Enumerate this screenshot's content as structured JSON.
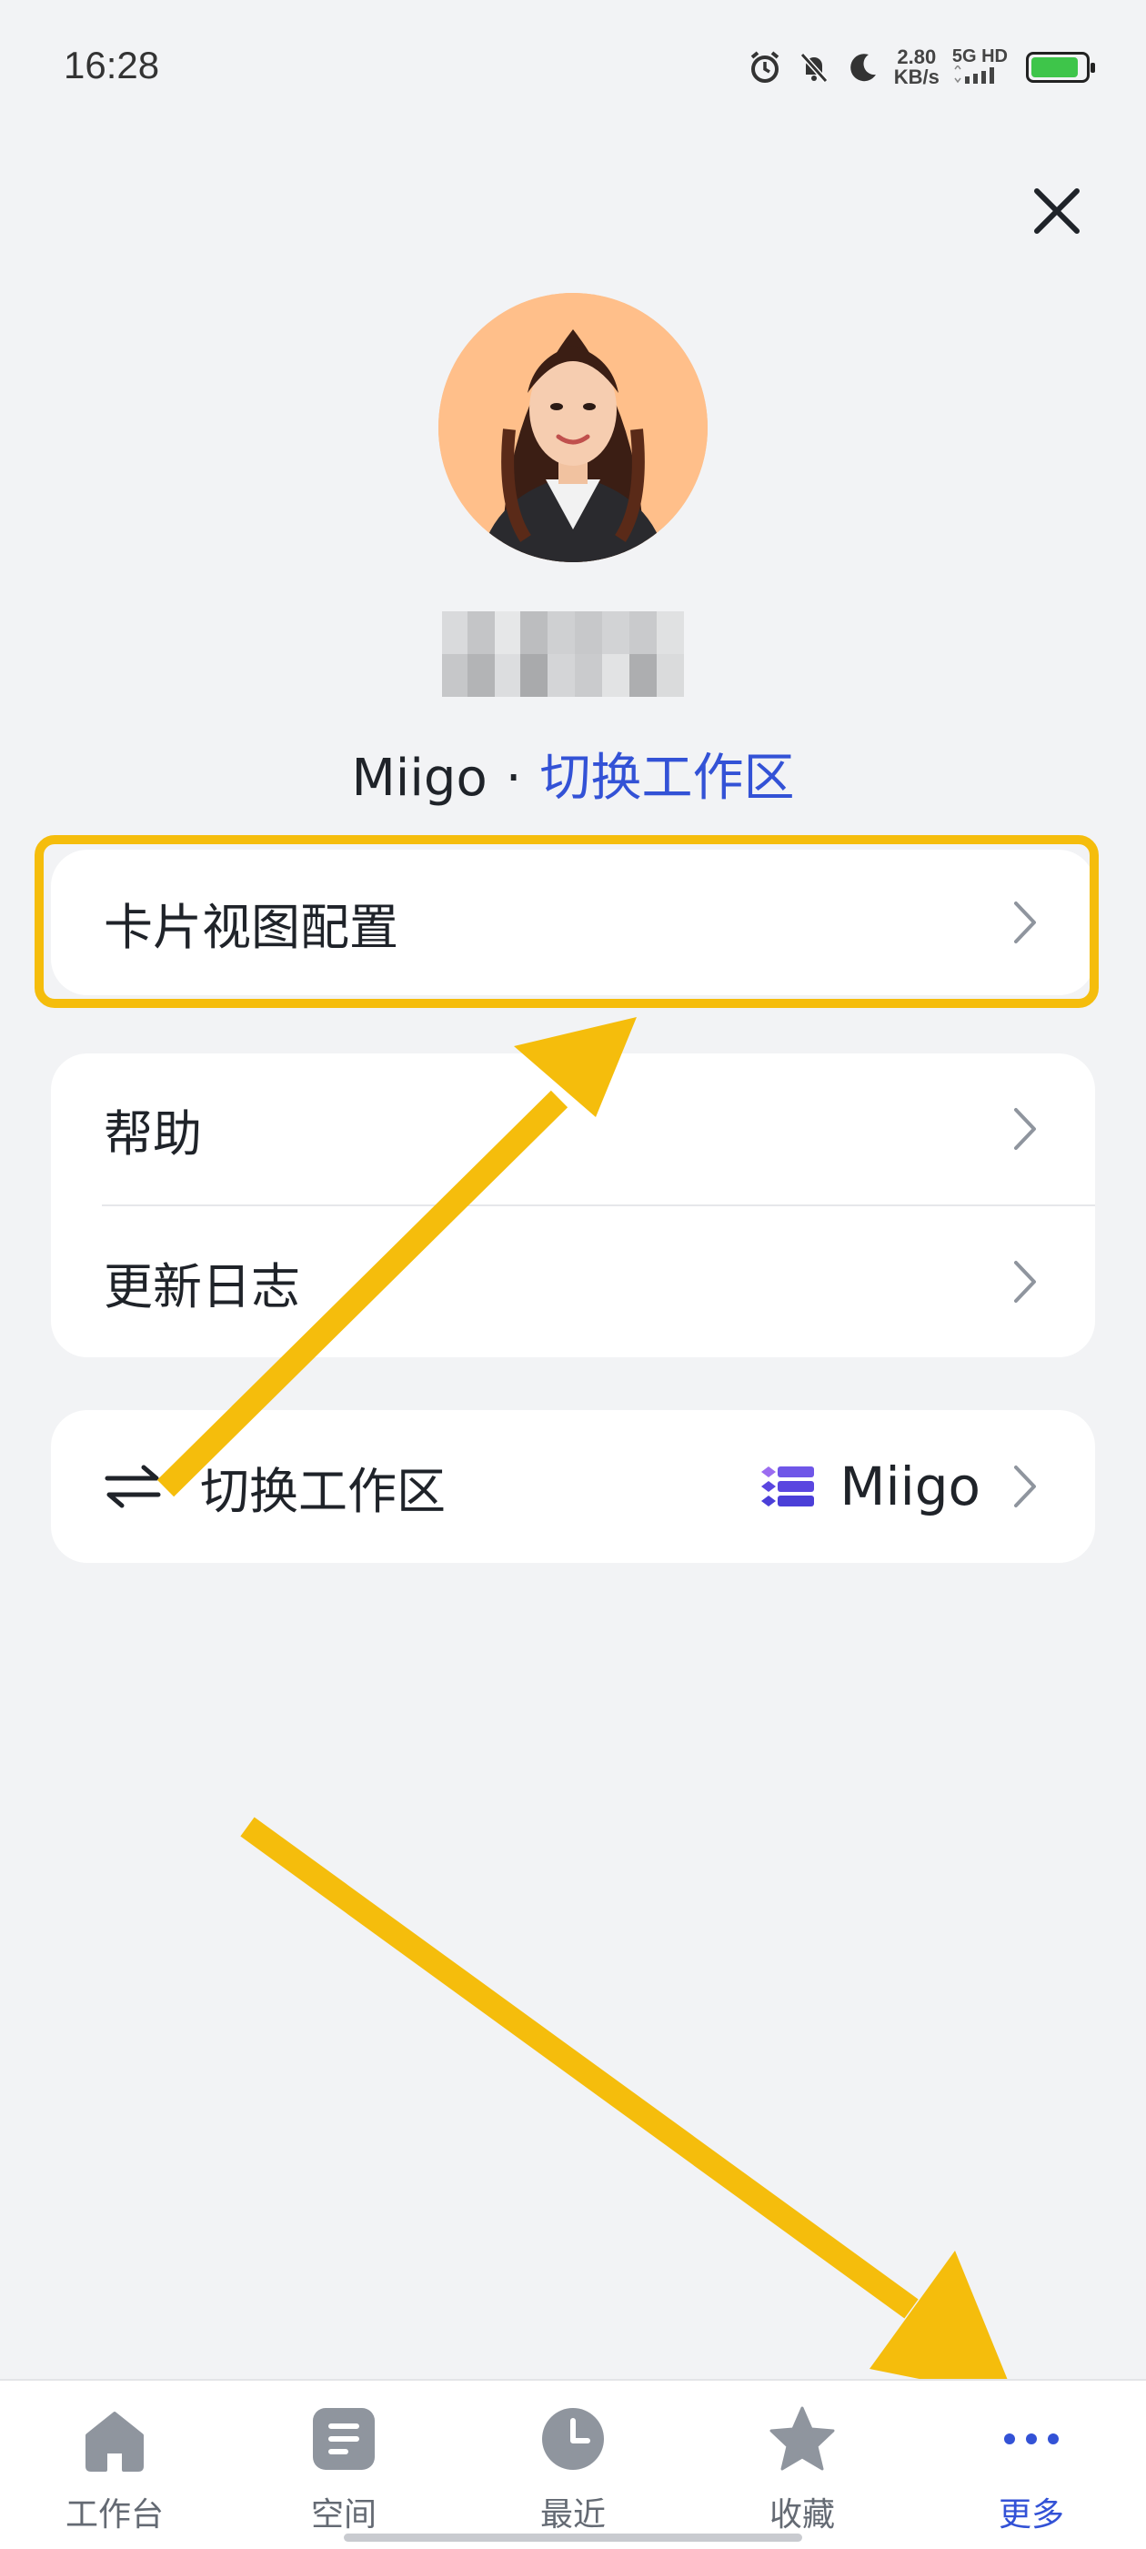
{
  "status_bar": {
    "time": "16:28",
    "speed_value": "2.80",
    "speed_unit": "KB/s",
    "network": "5G HD",
    "icons": [
      "alarm-icon",
      "mute-icon",
      "moon-icon",
      "signal-icon",
      "battery-icon"
    ]
  },
  "profile": {
    "workspace_name": "Miigo",
    "separator": "·",
    "switch_link": "切换工作区"
  },
  "menu": {
    "card_view_config": "卡片视图配置",
    "help": "帮助",
    "changelog": "更新日志",
    "switch_workspace": "切换工作区",
    "current_workspace": "Miigo"
  },
  "tabbar": {
    "tabs": [
      {
        "label": "工作台",
        "icon": "home-icon"
      },
      {
        "label": "空间",
        "icon": "space-icon"
      },
      {
        "label": "最近",
        "icon": "clock-icon"
      },
      {
        "label": "收藏",
        "icon": "star-icon"
      },
      {
        "label": "更多",
        "icon": "more-icon"
      }
    ],
    "active_index": 4
  },
  "colors": {
    "accent": "#3352d6",
    "highlight": "#f5bd0c",
    "background": "#f2f3f5"
  }
}
